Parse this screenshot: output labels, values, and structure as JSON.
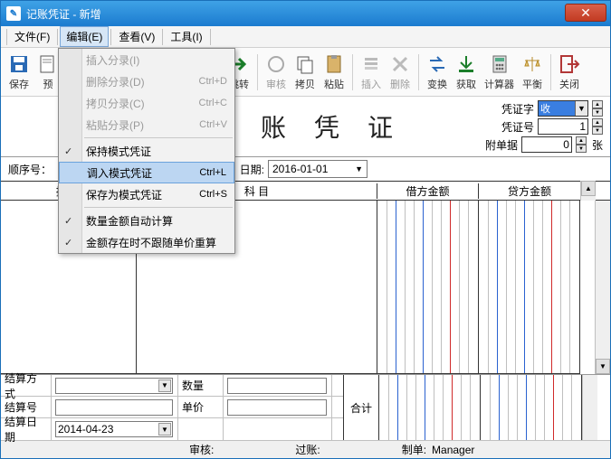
{
  "window": {
    "title": "记账凭证 - 新增"
  },
  "menubar": {
    "file": "文件(F)",
    "edit": "编辑(E)",
    "view": "查看(V)",
    "tools": "工具(I)"
  },
  "toolbar": {
    "save": "保存",
    "preview": "预",
    "insert_row": "插入分录(I)",
    "delete_row": "删除分录(D)",
    "copy_row": "拷贝分录(C)",
    "paste_row": "粘贴分录(P)",
    "jump": "跳转",
    "audit": "审核",
    "copy": "拷贝",
    "paste": "粘贴",
    "insert": "插入",
    "delete": "删除",
    "convert": "变换",
    "get": "获取",
    "calculator": "计算器",
    "balance": "平衡",
    "close": "关闭"
  },
  "dropdown": {
    "insert_row": "插入分录(I)",
    "delete_row": "删除分录(D)",
    "delete_row_sc": "Ctrl+D",
    "copy_row": "拷贝分录(C)",
    "copy_row_sc": "Ctrl+C",
    "paste_row": "粘贴分录(P)",
    "paste_row_sc": "Ctrl+V",
    "keep_template": "保持模式凭证",
    "load_template": "调入模式凭证",
    "load_template_sc": "Ctrl+L",
    "save_as_template": "保存为模式凭证",
    "save_as_template_sc": "Ctrl+S",
    "auto_calc": "数量金额自动计算",
    "keep_price": "金额存在时不跟随单价重算"
  },
  "header": {
    "title": "记 账 凭 证",
    "voucher_word_lbl": "凭证字",
    "voucher_word_val": "收",
    "voucher_no_lbl": "凭证号",
    "voucher_no_val": "1",
    "attach_lbl": "附单据",
    "attach_val": "0",
    "attach_unit": "张",
    "seq_lbl": "顺序号：",
    "date_lbl": "日期:",
    "date_val": "2016-01-01"
  },
  "columns": {
    "summary": "摘 要",
    "subject": "科 目",
    "debit": "借方金额",
    "credit": "贷方金额"
  },
  "footer": {
    "settle_method": "结算方式",
    "qty": "数量",
    "settle_no": "结算号",
    "price": "单价",
    "settle_date": "结算日期",
    "settle_date_val": "2014-04-23",
    "total": "合计"
  },
  "statusbar": {
    "audit": "审核:",
    "post": "过账:",
    "maker": "制单:",
    "maker_val": "Manager"
  },
  "colors": {
    "red": "#d02a2a",
    "blue": "#2a62d0",
    "gray": "#bfbfbf"
  }
}
